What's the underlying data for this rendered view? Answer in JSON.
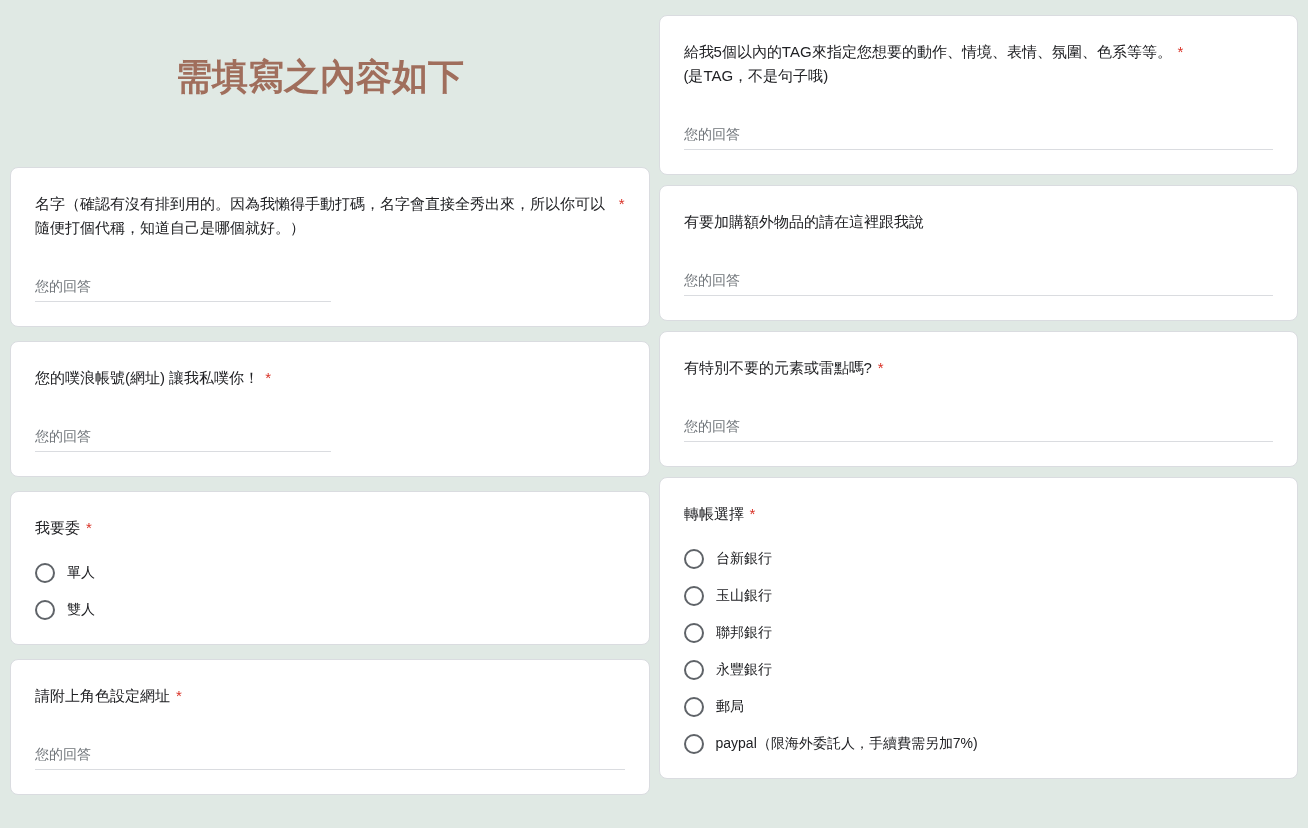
{
  "header": {
    "title": "需填寫之內容如下"
  },
  "left_column": [
    {
      "kind": "text",
      "question": "名字（確認有沒有排到用的。因為我懶得手動打碼，名字會直接全秀出來，所以你可以隨便打個代稱，知道自己是哪個就好。）",
      "required_mark": "*",
      "placeholder": "您的回答",
      "short_field": true
    },
    {
      "kind": "text",
      "question": "您的噗浪帳號(網址) 讓我私噗你！",
      "required_mark": "*",
      "placeholder": "您的回答",
      "short_field": true
    },
    {
      "kind": "choice",
      "question": "我要委",
      "required_mark": "*",
      "options": [
        {
          "label": "單人",
          "selected": false
        },
        {
          "label": "雙人",
          "selected": false
        }
      ]
    },
    {
      "kind": "text",
      "question": "請附上角色設定網址",
      "required_mark": "*",
      "placeholder": "您的回答",
      "short_field": false
    }
  ],
  "right_column": [
    {
      "kind": "text",
      "question": "給我5個以內的TAG來指定您想要的動作、情境、表情、氛圍、色系等等。\n(是TAG，不是句子哦)",
      "required_mark": "*",
      "placeholder": "您的回答",
      "short_field": false
    },
    {
      "kind": "text",
      "question": "有要加購額外物品的請在這裡跟我說",
      "placeholder": "您的回答",
      "short_field": false
    },
    {
      "kind": "text",
      "question": "有特別不要的元素或雷點嗎?",
      "required_mark": "*",
      "placeholder": "您的回答",
      "short_field": false
    },
    {
      "kind": "choice",
      "question": "轉帳選擇",
      "required_mark": "*",
      "options": [
        {
          "label": "台新銀行",
          "selected": false
        },
        {
          "label": "玉山銀行",
          "selected": false
        },
        {
          "label": "聯邦銀行",
          "selected": false
        },
        {
          "label": "永豐銀行",
          "selected": false
        },
        {
          "label": "郵局",
          "selected": false
        },
        {
          "label": "paypal（限海外委託人，手續費需另加7%)",
          "selected": false
        }
      ]
    }
  ]
}
